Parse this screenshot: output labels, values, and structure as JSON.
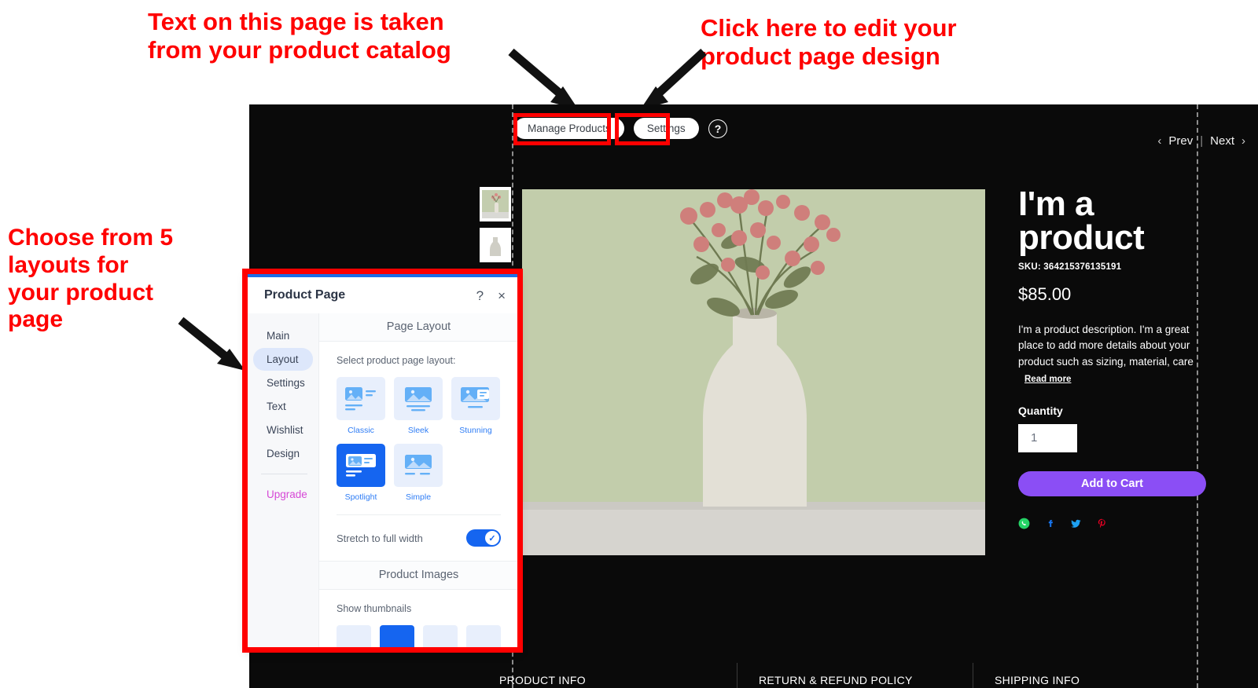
{
  "annotations": {
    "top_left": "Text on this page is taken\nfrom your product catalog",
    "top_right": "Click here to edit your\nproduct page design",
    "left": "Choose from 5\nlayouts for\nyour product\npage",
    "color": "#ff0000"
  },
  "toolbar": {
    "manage_products": "Manage Products",
    "settings": "Settings",
    "help_icon": "help-circle-icon"
  },
  "pager": {
    "prev": "Prev",
    "next": "Next",
    "prev_icon": "chevron-left-icon",
    "next_icon": "chevron-right-icon",
    "separator": "|"
  },
  "product": {
    "title": "I'm a product",
    "sku": "SKU: 364215376135191",
    "price": "$85.00",
    "description": "I'm a product description. I'm a great place to add more details about your product such as sizing, material, care",
    "read_more": "Read more",
    "quantity_label": "Quantity",
    "quantity_value": "1",
    "add_to_cart": "Add to Cart",
    "cart_color": "#8b4ef5",
    "socials": [
      {
        "name": "whatsapp-icon",
        "color": "#25d366"
      },
      {
        "name": "facebook-icon",
        "color": "#1877f2"
      },
      {
        "name": "twitter-icon",
        "color": "#1da1f2"
      },
      {
        "name": "pinterest-icon",
        "color": "#e60023"
      }
    ],
    "thumbnails": [
      "product-thumbnail-1",
      "product-thumbnail-2"
    ]
  },
  "footer": {
    "columns": [
      "PRODUCT INFO",
      "RETURN & REFUND POLICY",
      "SHIPPING INFO"
    ]
  },
  "panel": {
    "title": "Product Page",
    "help_label": "?",
    "close_label": "×",
    "nav": [
      {
        "label": "Main",
        "active": false
      },
      {
        "label": "Layout",
        "active": true
      },
      {
        "label": "Settings",
        "active": false
      },
      {
        "label": "Text",
        "active": false
      },
      {
        "label": "Wishlist",
        "active": false
      },
      {
        "label": "Design",
        "active": false
      }
    ],
    "upgrade": "Upgrade",
    "section_page_layout": "Page Layout",
    "select_layout_label": "Select product page layout:",
    "layouts": [
      {
        "name": "Classic",
        "selected": false
      },
      {
        "name": "Sleek",
        "selected": false
      },
      {
        "name": "Stunning",
        "selected": false
      },
      {
        "name": "Spotlight",
        "selected": true
      },
      {
        "name": "Simple",
        "selected": false
      }
    ],
    "stretch_label": "Stretch to full width",
    "stretch_on": true,
    "section_product_images": "Product Images",
    "show_thumbnails_label": "Show thumbnails",
    "thumbnail_positions": [
      {
        "selected": false
      },
      {
        "selected": true
      },
      {
        "selected": false
      },
      {
        "selected": false
      }
    ],
    "accent_color": "#1565f0"
  }
}
